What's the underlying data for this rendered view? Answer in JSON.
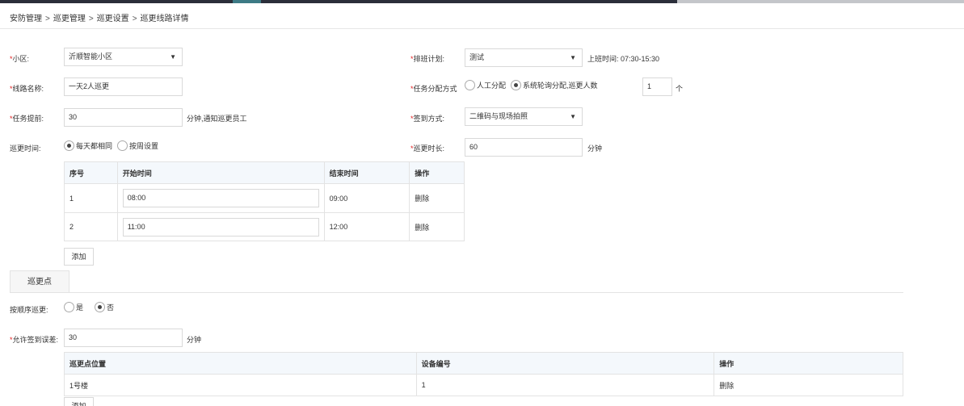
{
  "breadcrumb": [
    "安防管理",
    "巡更管理",
    "巡更设置",
    "巡更线路详情"
  ],
  "form": {
    "community": {
      "label": "小区:",
      "value": "沂顺智能小区"
    },
    "schedule": {
      "label": "排班计划:",
      "value": "测试",
      "shift_time": "上班时间: 07:30-15:30"
    },
    "route_name": {
      "label": "线路名称:",
      "value": "一天2人巡更"
    },
    "assign": {
      "label": "任务分配方式",
      "opt_manual": "人工分配",
      "opt_auto": "系统轮询分配,巡更人数",
      "count": "1",
      "unit": "个",
      "selected": "auto"
    },
    "advance": {
      "label": "任务提前:",
      "value": "30",
      "suffix": "分钟,通知巡更员工"
    },
    "checkin": {
      "label": "签到方式:",
      "value": "二维码与现场拍照"
    },
    "patrol_time": {
      "label": "巡更时间:",
      "opt_same": "每天都相同",
      "opt_week": "按周设置",
      "selected": "same"
    },
    "duration": {
      "label": "巡更时长:",
      "value": "60",
      "unit": "分钟"
    }
  },
  "time_table": {
    "headers": [
      "序号",
      "开始时间",
      "结束时间",
      "操作"
    ],
    "rows": [
      {
        "no": "1",
        "start": "08:00",
        "end": "09:00",
        "action": "删除"
      },
      {
        "no": "2",
        "start": "11:00",
        "end": "12:00",
        "action": "删除"
      }
    ],
    "add_label": "添加"
  },
  "tab_label": "巡更点",
  "points": {
    "order": {
      "label": "按顺序巡更:",
      "opt_yes": "是",
      "opt_no": "否",
      "selected": "no"
    },
    "tolerance": {
      "label": "允许签到误差:",
      "value": "30",
      "unit": "分钟"
    },
    "table": {
      "headers": [
        "巡更点位置",
        "设备编号",
        "操作"
      ],
      "rows": [
        {
          "location": "1号楼",
          "device": "1",
          "action": "删除"
        }
      ],
      "add_label": "添加"
    }
  },
  "required_mark": "*",
  "caret_icon": "▼"
}
